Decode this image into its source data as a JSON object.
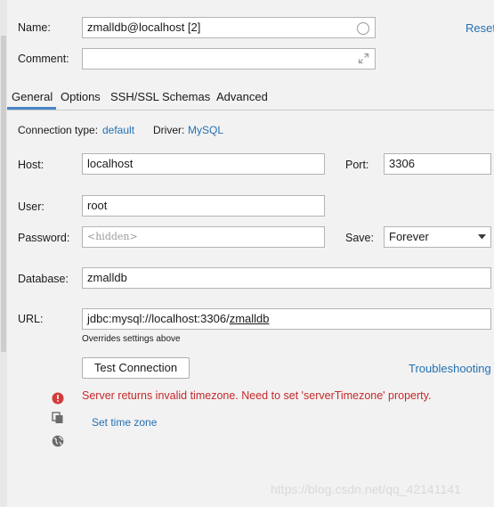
{
  "form": {
    "name_label": "Name:",
    "name_value": "zmalldb@localhost [2]",
    "reset_label": "Reset",
    "comment_label": "Comment:",
    "comment_value": ""
  },
  "tabs": [
    {
      "label": "General",
      "active": true
    },
    {
      "label": "Options",
      "active": false
    },
    {
      "label": "SSH/SSL",
      "active": false
    },
    {
      "label": "Schemas",
      "active": false
    },
    {
      "label": "Advanced",
      "active": false
    }
  ],
  "connection": {
    "type_label": "Connection type:",
    "type_value": "default",
    "driver_label": "Driver:",
    "driver_value": "MySQL"
  },
  "fields": {
    "host_label": "Host:",
    "host_value": "localhost",
    "port_label": "Port:",
    "port_value": "3306",
    "user_label": "User:",
    "user_value": "root",
    "password_label": "Password:",
    "password_placeholder": "<hidden>",
    "save_label": "Save:",
    "save_value": "Forever",
    "database_label": "Database:",
    "database_value": "zmalldb",
    "url_label": "URL:",
    "url_prefix": "jdbc:mysql://localhost:3306/",
    "url_db": "zmalldb",
    "url_note": "Overrides settings above"
  },
  "actions": {
    "test_connection": "Test Connection",
    "troubleshooting": "Troubleshooting"
  },
  "messages": {
    "error": "Server returns invalid timezone. Need to set 'serverTimezone' property.",
    "set_time_zone": "Set time zone"
  },
  "watermark": "https://blog.csdn.net/qq_42141141",
  "colors": {
    "link": "#2470b3",
    "error": "#c62828",
    "tab_active_underline": "#4a86c8",
    "background": "#f2f2f2"
  },
  "icons": [
    "error-icon",
    "copy-icon",
    "globe-icon",
    "expand-icon",
    "circle-icon",
    "dropdown-arrow-icon"
  ]
}
